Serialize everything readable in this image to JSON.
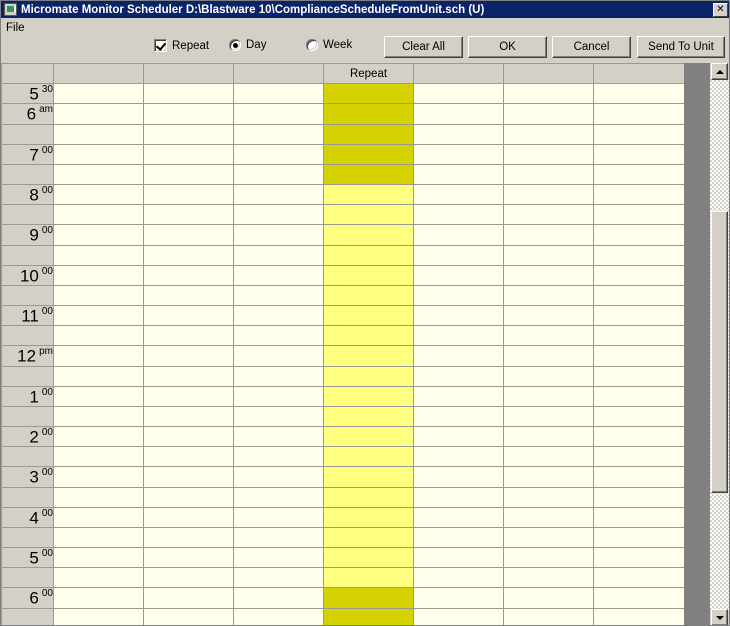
{
  "window": {
    "app_name": "Micromate Monitor Scheduler",
    "title": "Micromate Monitor Scheduler   D:\\Blastware 10\\ComplianceScheduleFromUnit.sch (U)",
    "close_label": "✕",
    "icon": "app-icon"
  },
  "menubar": {
    "items": [
      {
        "label": "File"
      }
    ]
  },
  "toolbar": {
    "repeat_checkbox": {
      "label": "Repeat",
      "checked": true
    },
    "radios": [
      {
        "label": "Day",
        "selected": true
      },
      {
        "label": "Week",
        "selected": false
      }
    ],
    "buttons": [
      {
        "label": "Clear All",
        "name": "clear-all-button"
      },
      {
        "label": "OK",
        "name": "ok-button"
      },
      {
        "label": "Cancel",
        "name": "cancel-button"
      },
      {
        "label": "Send To Unit",
        "name": "send-to-unit-button"
      }
    ]
  },
  "grid": {
    "column_headers": [
      "",
      "",
      "",
      "Repeat",
      "",
      "",
      ""
    ],
    "repeat_column_index": 3,
    "rows": [
      {
        "hour": "5",
        "minute": "30",
        "states": [
          "empty",
          "empty",
          "empty",
          "dark",
          "empty",
          "empty",
          "empty"
        ]
      },
      {
        "hour": "6",
        "minute": "am",
        "states": [
          "empty",
          "empty",
          "empty",
          "dark",
          "empty",
          "empty",
          "empty"
        ]
      },
      {
        "hour": "",
        "minute": "",
        "states": [
          "empty",
          "empty",
          "empty",
          "dark",
          "empty",
          "empty",
          "empty"
        ]
      },
      {
        "hour": "7",
        "minute": "00",
        "states": [
          "empty",
          "empty",
          "empty",
          "dark",
          "empty",
          "empty",
          "empty"
        ]
      },
      {
        "hour": "",
        "minute": "",
        "states": [
          "empty",
          "empty",
          "empty",
          "dark",
          "empty",
          "empty",
          "empty"
        ]
      },
      {
        "hour": "8",
        "minute": "00",
        "states": [
          "empty",
          "empty",
          "empty",
          "light",
          "empty",
          "empty",
          "empty"
        ]
      },
      {
        "hour": "",
        "minute": "",
        "states": [
          "empty",
          "empty",
          "empty",
          "light",
          "empty",
          "empty",
          "empty"
        ]
      },
      {
        "hour": "9",
        "minute": "00",
        "states": [
          "empty",
          "empty",
          "empty",
          "light",
          "empty",
          "empty",
          "empty"
        ]
      },
      {
        "hour": "",
        "minute": "",
        "states": [
          "empty",
          "empty",
          "empty",
          "light",
          "empty",
          "empty",
          "empty"
        ]
      },
      {
        "hour": "10",
        "minute": "00",
        "states": [
          "empty",
          "empty",
          "empty",
          "light",
          "empty",
          "empty",
          "empty"
        ]
      },
      {
        "hour": "",
        "minute": "",
        "states": [
          "empty",
          "empty",
          "empty",
          "light",
          "empty",
          "empty",
          "empty"
        ]
      },
      {
        "hour": "11",
        "minute": "00",
        "states": [
          "empty",
          "empty",
          "empty",
          "light",
          "empty",
          "empty",
          "empty"
        ]
      },
      {
        "hour": "",
        "minute": "",
        "states": [
          "empty",
          "empty",
          "empty",
          "light",
          "empty",
          "empty",
          "empty"
        ]
      },
      {
        "hour": "12",
        "minute": "pm",
        "states": [
          "empty",
          "empty",
          "empty",
          "light",
          "empty",
          "empty",
          "empty"
        ]
      },
      {
        "hour": "",
        "minute": "",
        "states": [
          "empty",
          "empty",
          "empty",
          "light",
          "empty",
          "empty",
          "empty"
        ]
      },
      {
        "hour": "1",
        "minute": "00",
        "states": [
          "empty",
          "empty",
          "empty",
          "light",
          "empty",
          "empty",
          "empty"
        ]
      },
      {
        "hour": "",
        "minute": "",
        "states": [
          "empty",
          "empty",
          "empty",
          "light",
          "empty",
          "empty",
          "empty"
        ]
      },
      {
        "hour": "2",
        "minute": "00",
        "states": [
          "empty",
          "empty",
          "empty",
          "light",
          "empty",
          "empty",
          "empty"
        ]
      },
      {
        "hour": "",
        "minute": "",
        "states": [
          "empty",
          "empty",
          "empty",
          "light",
          "empty",
          "empty",
          "empty"
        ]
      },
      {
        "hour": "3",
        "minute": "00",
        "states": [
          "empty",
          "empty",
          "empty",
          "light",
          "empty",
          "empty",
          "empty"
        ]
      },
      {
        "hour": "",
        "minute": "",
        "states": [
          "empty",
          "empty",
          "empty",
          "light",
          "empty",
          "empty",
          "empty"
        ]
      },
      {
        "hour": "4",
        "minute": "00",
        "states": [
          "empty",
          "empty",
          "empty",
          "light",
          "empty",
          "empty",
          "empty"
        ]
      },
      {
        "hour": "",
        "minute": "",
        "states": [
          "empty",
          "empty",
          "empty",
          "light",
          "empty",
          "empty",
          "empty"
        ]
      },
      {
        "hour": "5",
        "minute": "00",
        "states": [
          "empty",
          "empty",
          "empty",
          "light",
          "empty",
          "empty",
          "empty"
        ]
      },
      {
        "hour": "",
        "minute": "",
        "states": [
          "empty",
          "empty",
          "empty",
          "light",
          "empty",
          "empty",
          "empty"
        ]
      },
      {
        "hour": "6",
        "minute": "00",
        "states": [
          "empty",
          "empty",
          "empty",
          "dark",
          "empty",
          "empty",
          "empty"
        ]
      },
      {
        "hour": "",
        "minute": "",
        "states": [
          "empty",
          "empty",
          "empty",
          "dark",
          "empty",
          "empty",
          "empty"
        ]
      }
    ]
  },
  "scrollbar": {
    "up_arrow": "scroll-up-arrow",
    "down_arrow": "scroll-down-arrow",
    "thumb": "scroll-thumb"
  },
  "colors": {
    "titlebar": "#0a246a",
    "face": "#d4d0c8",
    "cell_empty": "#ffffec",
    "cell_selected_dark": "#d6d100",
    "cell_selected_light": "#ffff80",
    "grid_line": "#9a9a94",
    "gray_strip": "#808080"
  }
}
